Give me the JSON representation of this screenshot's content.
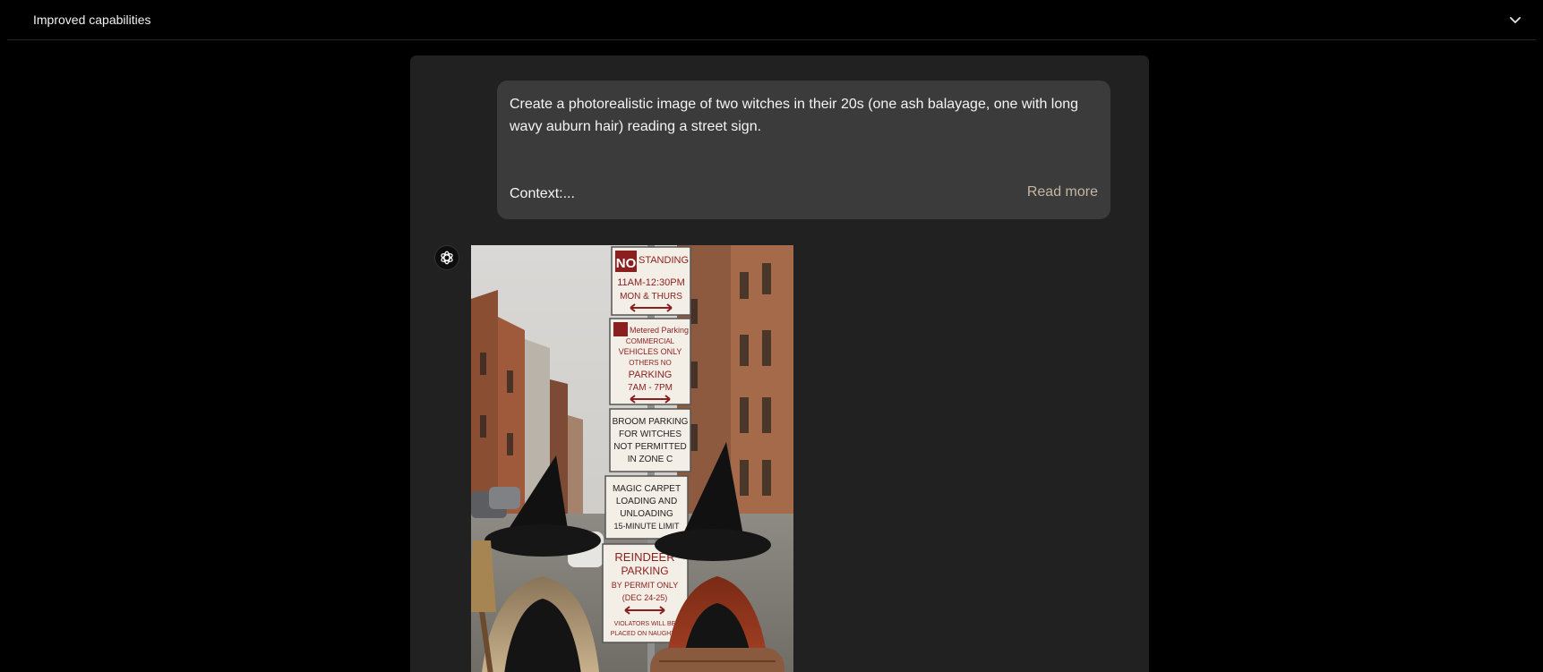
{
  "header": {
    "title": "Improved capabilities",
    "toggle_icon": "chevron-down-icon"
  },
  "conversation": {
    "user_message": {
      "text": "Create a photorealistic image of two witches in their 20s (one ash balayage, one with long wavy auburn hair) reading a street sign.",
      "context": "Context:...",
      "read_more": "Read more"
    },
    "assistant": {
      "avatar_icon": "openai-logo-icon"
    },
    "image_signs": {
      "s1_a": "NO",
      "s1_b": "STANDING",
      "s1_c": "11AM-12:30PM",
      "s1_d": "MON & THURS",
      "s2_a": "Metered Parking",
      "s2_b": "COMMERCIAL",
      "s2_c": "VEHICLES ONLY",
      "s2_d": "OTHERS NO",
      "s2_e": "PARKING",
      "s2_f": "7AM - 7PM",
      "s3_a": "BROOM PARKING",
      "s3_b": "FOR WITCHES",
      "s3_c": "NOT PERMITTED",
      "s3_d": "IN ZONE C",
      "s4_a": "MAGIC CARPET",
      "s4_b": "LOADING AND",
      "s4_c": "UNLOADING",
      "s4_d": "15-MINUTE LIMIT",
      "s5_a": "REINDEER",
      "s5_b": "PARKING",
      "s5_c": "BY PERMIT ONLY",
      "s5_d": "(DEC 24-25)",
      "s5_e": "VIOLATORS WILL BE",
      "s5_f": "PLACED ON NAUGHTY"
    }
  },
  "colors": {
    "background": "#000000",
    "panel": "#212121",
    "bubble": "#3b3b3b",
    "read_more": "#c3b6a3",
    "sign_red": "#8b1e1e"
  }
}
